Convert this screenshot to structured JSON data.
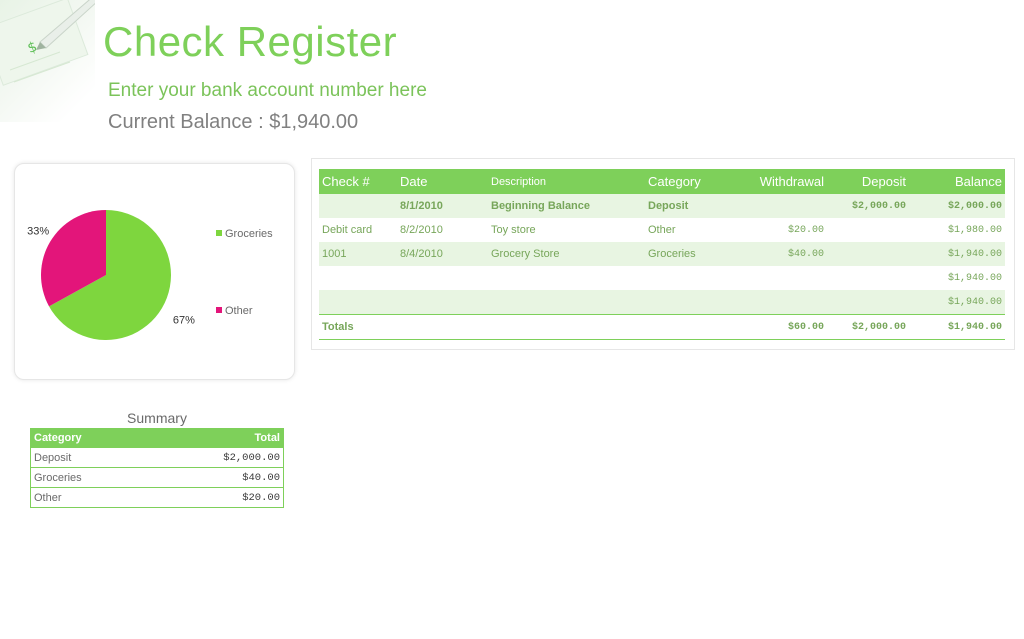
{
  "header": {
    "title": "Check Register",
    "account_placeholder": "Enter your bank account number here",
    "balance_label": "Current Balance :",
    "balance_value": "$1,940.00"
  },
  "chart_data": {
    "type": "pie",
    "categories": [
      "Groceries",
      "Other"
    ],
    "values": [
      67,
      33
    ],
    "labels": [
      "67%",
      "33%"
    ],
    "colors": [
      "#7ed63e",
      "#e3157a"
    ],
    "legend_position": "right"
  },
  "summary": {
    "title": "Summary",
    "columns": [
      "Category",
      "Total"
    ],
    "rows": [
      {
        "category": "Deposit",
        "total": "$2,000.00"
      },
      {
        "category": "Groceries",
        "total": "$40.00"
      },
      {
        "category": "Other",
        "total": "$20.00"
      }
    ]
  },
  "register": {
    "columns": [
      "Check #",
      "Date",
      "Description",
      "Category",
      "Withdrawal",
      "Deposit",
      "Balance"
    ],
    "rows": [
      {
        "check": "",
        "date": "8/1/2010",
        "description": "Beginning Balance",
        "category": "Deposit",
        "withdrawal": "",
        "deposit": "$2,000.00",
        "balance": "$2,000.00"
      },
      {
        "check": "Debit card",
        "date": "8/2/2010",
        "description": "Toy store",
        "category": "Other",
        "withdrawal": "$20.00",
        "deposit": "",
        "balance": "$1,980.00"
      },
      {
        "check": "1001",
        "date": "8/4/2010",
        "description": "Grocery Store",
        "category": "Groceries",
        "withdrawal": "$40.00",
        "deposit": "",
        "balance": "$1,940.00"
      },
      {
        "check": "",
        "date": "",
        "description": "",
        "category": "",
        "withdrawal": "",
        "deposit": "",
        "balance": "$1,940.00"
      },
      {
        "check": "",
        "date": "",
        "description": "",
        "category": "",
        "withdrawal": "",
        "deposit": "",
        "balance": "$1,940.00"
      }
    ],
    "totals": {
      "label": "Totals",
      "withdrawal": "$60.00",
      "deposit": "$2,000.00",
      "balance": "$1,940.00"
    }
  },
  "colors": {
    "accent": "#7ed05a",
    "title": "#7ed05a",
    "row_alt": "#e8f5e2",
    "pie_green": "#7ed63e",
    "pie_pink": "#e3157a"
  },
  "icons": {
    "corner": "check-pen-icon"
  }
}
